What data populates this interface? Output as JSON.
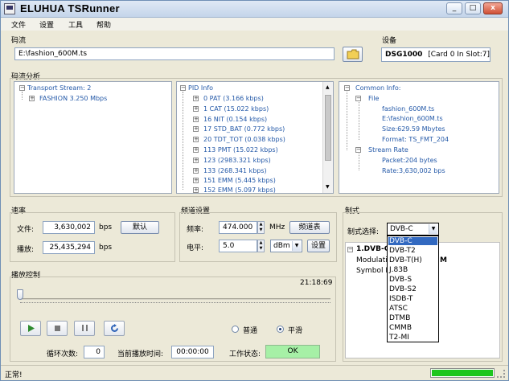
{
  "window": {
    "title": "ELUHUA  TSRunner",
    "btn_min": "_",
    "btn_max": "□",
    "btn_close": "x"
  },
  "menu": [
    "文件",
    "设置",
    "工具",
    "帮助"
  ],
  "stream": {
    "label": "码流",
    "path": "E:\\fashion_600M.ts"
  },
  "device": {
    "label": "设备",
    "name": "DSG1000",
    "slot": "[Card 0 In Slot:7]"
  },
  "analysis": {
    "label": "码流分析",
    "ts_tree": [
      "Transport Stream: 2",
      "FASHION 3.250 Mbps"
    ],
    "pid_tree": [
      "PID Info",
      "0 PAT (3.166 kbps)",
      "1 CAT (15.022 kbps)",
      "16 NIT (0.154 kbps)",
      "17 STD_BAT (0.772 kbps)",
      "20 TDT_TOT (0.038 kbps)",
      "113 PMT (15.022 kbps)",
      "123  (2983.321 kbps)",
      "133  (268.341 kbps)",
      "151 EMM (5.445 kbps)",
      "152 EMM (5.097 kbps)"
    ],
    "info_tree": {
      "root": "Common Info:",
      "file": "File",
      "file_items": [
        "fashion_600M.ts",
        "E:\\fashion_600M.ts",
        "Size:629.59 Mbytes",
        "Format: TS_FMT_204"
      ],
      "rate": "Stream Rate",
      "rate_items": [
        "Packet:204 bytes",
        "Rate:3,630,002 bps"
      ]
    }
  },
  "rate": {
    "label": "速率",
    "file_label": "文件:",
    "file_value": "3,630,002",
    "file_unit": "bps",
    "default_btn": "默认",
    "play_label": "播放:",
    "play_value": "25,435,294",
    "play_unit": "bps"
  },
  "freq": {
    "label": "频道设置",
    "freq_label": "频率:",
    "freq_value": "474.000",
    "freq_unit": "MHz",
    "freq_btn": "频道表",
    "level_label": "电平:",
    "level_value": "5.0",
    "level_unit": "dBm",
    "level_btn": "设置"
  },
  "modulation": {
    "label": "制式",
    "select_label": "制式选择:",
    "selected": "DVB-C",
    "section_title": "1.DVB-C",
    "modulation_label": "Modulatio",
    "modulation_value": "M",
    "symbol_label": "Symbol R",
    "options": [
      "DVB-C",
      "DVB-T2",
      "DVB-T(H)",
      "J.83B",
      "DVB-S",
      "DVB-S2",
      "ISDB-T",
      "ATSC",
      "DTMB",
      "CMMB",
      "T2-MI"
    ]
  },
  "playback": {
    "label": "播放控制",
    "time": "21:18:69",
    "progress": 0.0,
    "mode_normal": "普通",
    "mode_smooth": "平滑",
    "selected_mode": "平滑",
    "loop_label": "循环次数:",
    "loop_value": "0",
    "current_time_label": "当前播放时间:",
    "current_time_value": "00:00:00",
    "state_label": "工作状态:",
    "state_value": "OK",
    "state_color": "#a6f0a6"
  },
  "status": {
    "text": "正常!",
    "progress_color": "#1ec61e"
  }
}
